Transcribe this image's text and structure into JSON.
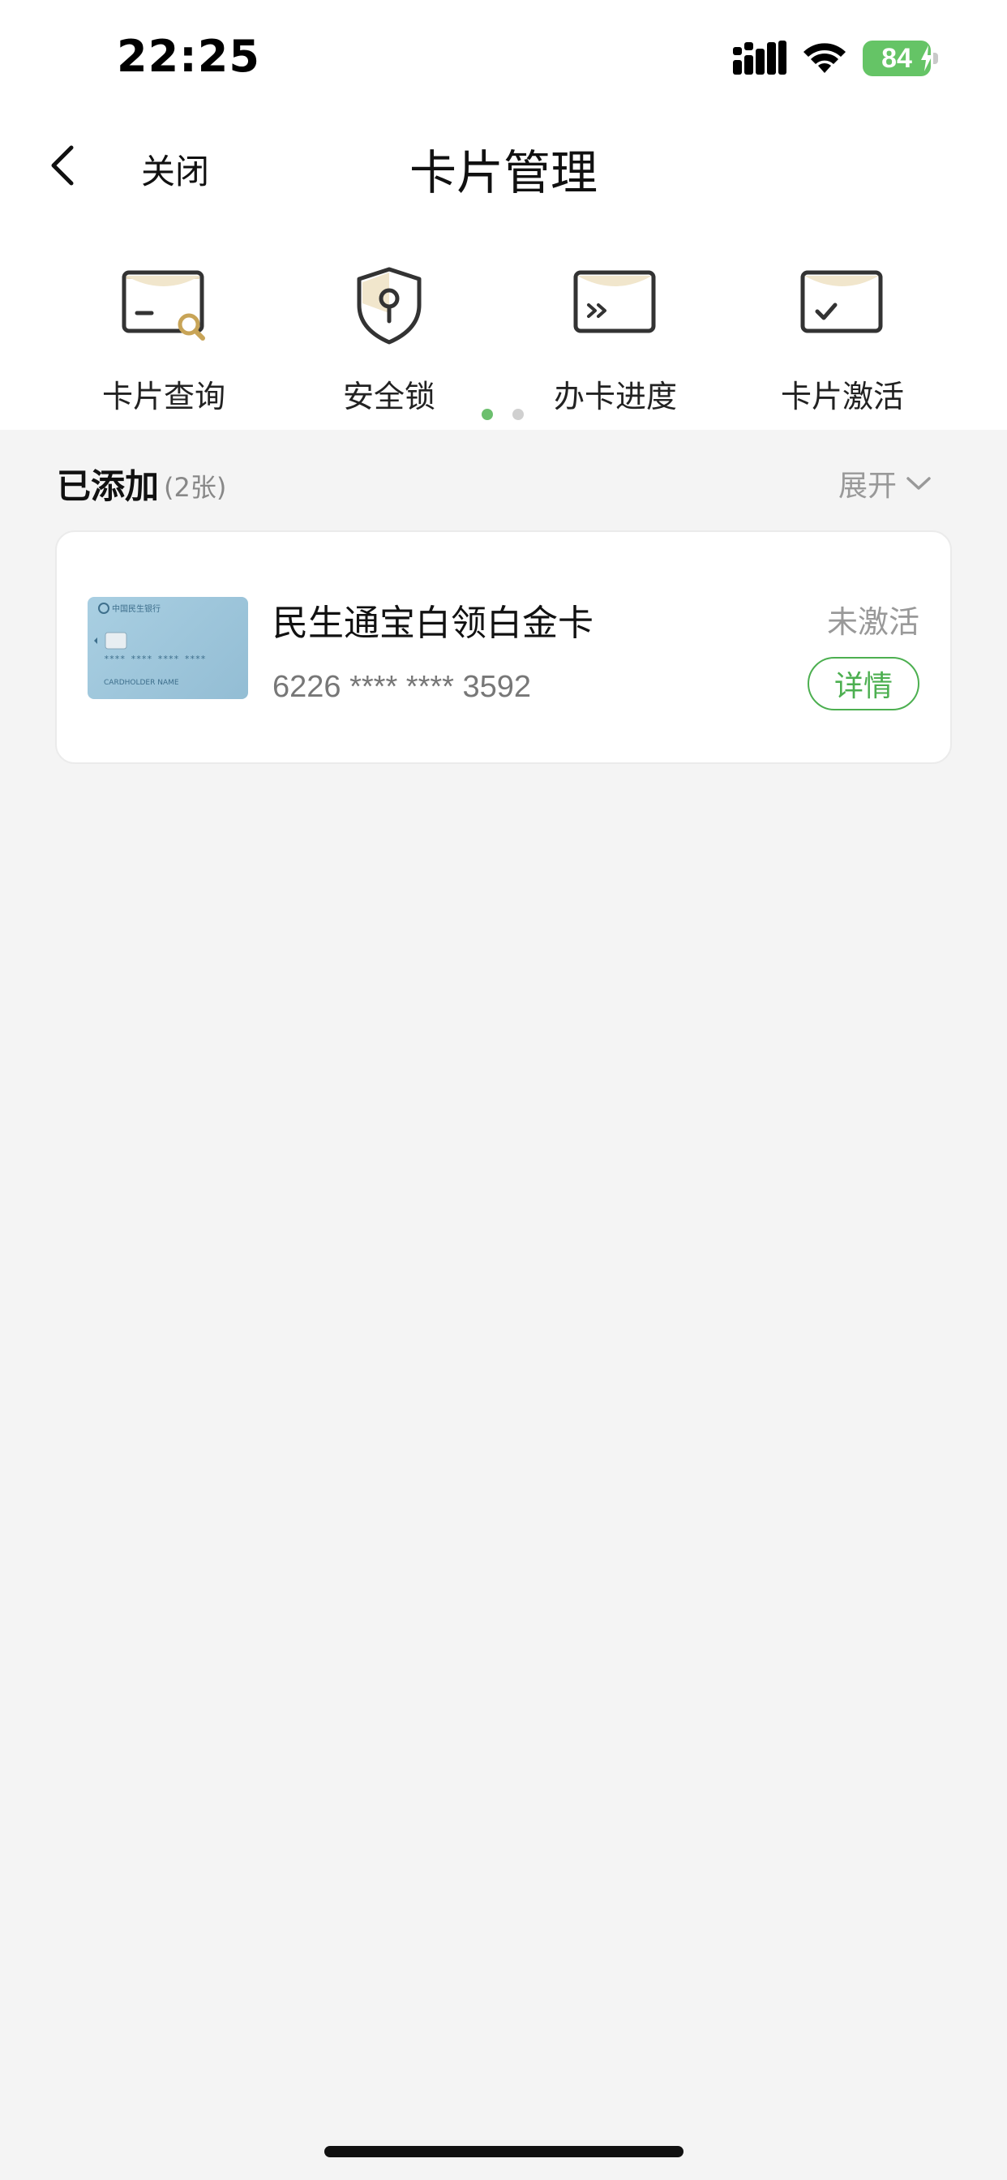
{
  "status_bar": {
    "time": "22:25",
    "battery": "84"
  },
  "nav": {
    "close_label": "关闭",
    "title": "卡片管理"
  },
  "quick_actions": [
    {
      "label": "卡片查询",
      "icon": "card-search-icon"
    },
    {
      "label": "安全锁",
      "icon": "shield-lock-icon"
    },
    {
      "label": "办卡进度",
      "icon": "card-progress-icon"
    },
    {
      "label": "卡片激活",
      "icon": "card-activate-icon"
    }
  ],
  "pager": {
    "active_index": 0,
    "count": 2
  },
  "section": {
    "title": "已添加",
    "count": "(2张)",
    "expand_label": "展开"
  },
  "cards": [
    {
      "name": "民生通宝白领白金卡",
      "number": "6226 **** **** 3592",
      "status": "未激活",
      "detail_label": "详情",
      "thumb": {
        "bank_text": "中国民生银行",
        "masked_number": "**** **** **** ****",
        "holder": "CARDHOLDER NAME"
      }
    }
  ],
  "colors": {
    "accent_green": "#4caf50",
    "battery_green": "#65c466",
    "icon_gold": "#e9dcc0"
  }
}
